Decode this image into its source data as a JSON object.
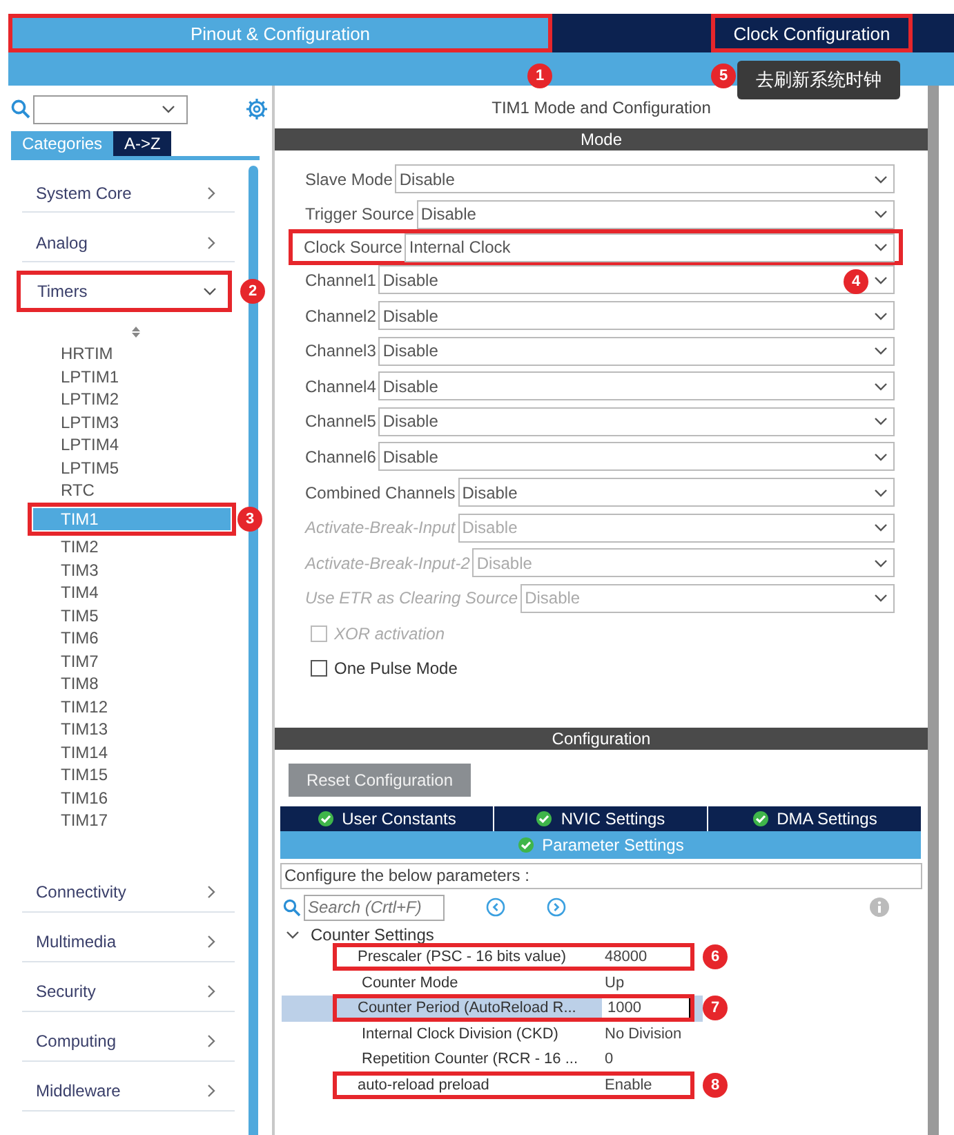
{
  "header_tabs": [
    {
      "label": "Pinout & Configuration",
      "selected": true,
      "callout": "1"
    },
    {
      "label": "Clock Configuration",
      "selected": false,
      "callout": "5",
      "tooltip": "去刷新系统时钟"
    }
  ],
  "sidebar": {
    "tabs": [
      {
        "label": "Categories",
        "selected": true
      },
      {
        "label": "A->Z",
        "selected": false
      }
    ],
    "categories": [
      {
        "label": "System Core",
        "expanded": false
      },
      {
        "label": "Analog",
        "expanded": false
      },
      {
        "label": "Timers",
        "expanded": true,
        "callout": "2",
        "children": [
          {
            "label": "HRTIM",
            "selected": false
          },
          {
            "label": "LPTIM1",
            "selected": false
          },
          {
            "label": "LPTIM2",
            "selected": false
          },
          {
            "label": "LPTIM3",
            "selected": false
          },
          {
            "label": "LPTIM4",
            "selected": false
          },
          {
            "label": "LPTIM5",
            "selected": false
          },
          {
            "label": "RTC",
            "selected": false
          },
          {
            "label": "TIM1",
            "selected": true,
            "callout": "3"
          },
          {
            "label": "TIM2",
            "selected": false
          },
          {
            "label": "TIM3",
            "selected": false
          },
          {
            "label": "TIM4",
            "selected": false
          },
          {
            "label": "TIM5",
            "selected": false
          },
          {
            "label": "TIM6",
            "selected": false
          },
          {
            "label": "TIM7",
            "selected": false
          },
          {
            "label": "TIM8",
            "selected": false
          },
          {
            "label": "TIM12",
            "selected": false
          },
          {
            "label": "TIM13",
            "selected": false
          },
          {
            "label": "TIM14",
            "selected": false
          },
          {
            "label": "TIM15",
            "selected": false
          },
          {
            "label": "TIM16",
            "selected": false
          },
          {
            "label": "TIM17",
            "selected": false
          }
        ]
      },
      {
        "label": "Connectivity",
        "expanded": false
      },
      {
        "label": "Multimedia",
        "expanded": false
      },
      {
        "label": "Security",
        "expanded": false
      },
      {
        "label": "Computing",
        "expanded": false
      },
      {
        "label": "Middleware",
        "expanded": false
      }
    ]
  },
  "panel": {
    "title": "TIM1 Mode and Configuration",
    "mode": {
      "header": "Mode",
      "fields": [
        {
          "kind": "select",
          "label": "Slave Mode",
          "value": "Disable",
          "disabled": false
        },
        {
          "kind": "select",
          "label": "Trigger Source",
          "value": "Disable",
          "disabled": false
        },
        {
          "kind": "select",
          "label": "Clock Source",
          "value": "Internal Clock",
          "disabled": false,
          "callout": "4"
        },
        {
          "kind": "select",
          "label": "Channel1",
          "value": "Disable",
          "disabled": false
        },
        {
          "kind": "select",
          "label": "Channel2",
          "value": "Disable",
          "disabled": false
        },
        {
          "kind": "select",
          "label": "Channel3",
          "value": "Disable",
          "disabled": false
        },
        {
          "kind": "select",
          "label": "Channel4",
          "value": "Disable",
          "disabled": false
        },
        {
          "kind": "select",
          "label": "Channel5",
          "value": "Disable",
          "disabled": false
        },
        {
          "kind": "select",
          "label": "Channel6",
          "value": "Disable",
          "disabled": false
        },
        {
          "kind": "select",
          "label": "Combined Channels",
          "value": "Disable",
          "disabled": false
        },
        {
          "kind": "select",
          "label": "Activate-Break-Input",
          "value": "Disable",
          "disabled": true
        },
        {
          "kind": "select",
          "label": "Activate-Break-Input-2",
          "value": "Disable",
          "disabled": true
        },
        {
          "kind": "select",
          "label": "Use ETR as Clearing Source",
          "value": "Disable",
          "disabled": true
        },
        {
          "kind": "checkbox",
          "label": "XOR activation",
          "checked": false,
          "disabled": true
        },
        {
          "kind": "checkbox",
          "label": "One Pulse Mode",
          "checked": false,
          "disabled": false
        }
      ]
    },
    "configuration": {
      "header": "Configuration",
      "reset_button": "Reset Configuration",
      "tabs": [
        {
          "label": "User Constants",
          "selected": false
        },
        {
          "label": "NVIC Settings",
          "selected": false
        },
        {
          "label": "DMA Settings",
          "selected": false
        },
        {
          "label": "Parameter Settings",
          "selected": true
        }
      ],
      "hint": "Configure the below parameters :",
      "search": {
        "placeholder": "Search (Crtl+F)"
      },
      "groups": [
        {
          "label": "Counter Settings",
          "expanded": true,
          "params": [
            {
              "name": "Prescaler (PSC - 16 bits value)",
              "value": "48000",
              "selected": false,
              "callout": "6"
            },
            {
              "name": "Counter Mode",
              "value": "Up",
              "selected": false
            },
            {
              "name": "Counter Period (AutoReload R...",
              "value": "1000",
              "selected": true,
              "callout": "7"
            },
            {
              "name": "Internal Clock Division (CKD)",
              "value": "No Division",
              "selected": false
            },
            {
              "name": "Repetition Counter (RCR - 16 ...",
              "value": "0",
              "selected": false
            },
            {
              "name": "auto-reload preload",
              "value": "Enable",
              "selected": false,
              "callout": "8"
            }
          ]
        }
      ]
    }
  }
}
